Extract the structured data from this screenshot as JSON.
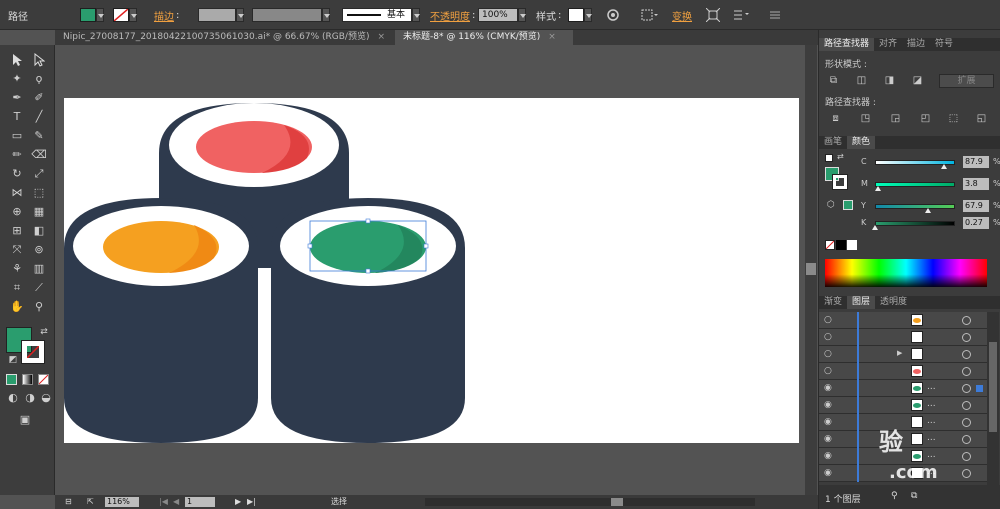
{
  "control_bar": {
    "object_type": "路径",
    "stroke_label": "描边",
    "stroke_profile": "基本",
    "opacity_label": "不透明度",
    "opacity_value": "100%",
    "style_label": "样式",
    "transform_label": "变换",
    "fill_color": "#2a9d6e"
  },
  "document_tabs": [
    {
      "label": "Nipic_27008177_20180422100735061030.ai* @ 66.67% (RGB/预览)",
      "close": "×"
    },
    {
      "label": "未标题-8* @ 116% (CMYK/预览)",
      "close": "×"
    }
  ],
  "tools": {
    "fill_color": "#2a9d6e"
  },
  "statusbar": {
    "zoom": "116%",
    "page": "1",
    "tool_name": "选择"
  },
  "pathfinder_panel": {
    "tabs": [
      "路径查找器",
      "对齐",
      "描边",
      "符号"
    ],
    "shape_modes_label": "形状模式 :",
    "pathfinders_label": "路径查找器 :",
    "expand_button": "扩展"
  },
  "color_panel": {
    "tabs": [
      "画笔",
      "颜色"
    ],
    "channels": [
      {
        "letter": "C",
        "value": "87.9",
        "fraction": 0.879,
        "gradient": "linear-gradient(to right,#fff,#00b4e0)",
        "pct": "%"
      },
      {
        "letter": "M",
        "value": "3.8",
        "fraction": 0.038,
        "gradient": "linear-gradient(to right,#0fb,#0a6)",
        "pct": "%"
      },
      {
        "letter": "Y",
        "value": "67.9",
        "fraction": 0.679,
        "gradient": "linear-gradient(to right,#18a,#5c5)",
        "pct": "%"
      },
      {
        "letter": "K",
        "value": "0.27",
        "fraction": 0.0027,
        "gradient": "linear-gradient(to right,#2a9d6e,#000)",
        "pct": "%"
      }
    ]
  },
  "layers_panel": {
    "tabs": [
      "渐变",
      "图层",
      "透明度"
    ],
    "rows": [
      {
        "thumb_color": "#f5a020",
        "visible": false,
        "dots": ""
      },
      {
        "thumb_color": "#ffffff",
        "visible": false,
        "dots": ""
      },
      {
        "thumb_color": "#ffffff",
        "visible": false,
        "dots": "",
        "expand": "▶"
      },
      {
        "thumb_color": "#f06262",
        "visible": false,
        "dots": ""
      },
      {
        "thumb_color": "#2a9d6e",
        "visible": true,
        "dots": "...",
        "selected": true
      },
      {
        "thumb_color": "#2a9d6e",
        "visible": true,
        "dots": "..."
      },
      {
        "thumb_color": "#ffffff",
        "visible": true,
        "dots": "..."
      },
      {
        "thumb_color": "#ffffff",
        "visible": true,
        "dots": "..."
      },
      {
        "thumb_color": "#2a9d6e",
        "visible": true,
        "dots": "..."
      },
      {
        "thumb_color": "#ffffff",
        "visible": true,
        "dots": "..."
      }
    ],
    "footer_label": "1 个图层"
  },
  "watermark": {
    "text": "验",
    "sub": ".com"
  },
  "artwork": {
    "roll_color": "#2e3a4d",
    "rice_color": "#ffffff",
    "tuna_color": "#f06262",
    "tuna_highlight": "#e04040",
    "tamago_color": "#f5a020",
    "tamago_highlight": "#f08a14",
    "cucumber_color": "#2a9d6e",
    "cucumber_highlight": "#23875e"
  }
}
